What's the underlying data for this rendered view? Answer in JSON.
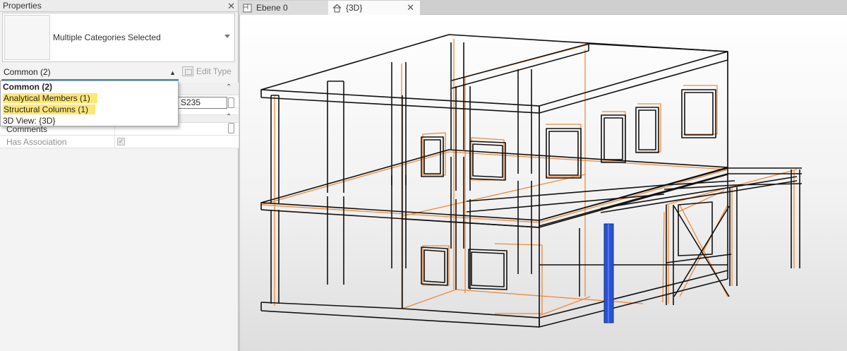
{
  "panel": {
    "title": "Properties",
    "close_glyph": "✕",
    "type_selector_label": "Multiple Categories Selected",
    "filter_value": "Common (2)",
    "edit_type_label": "Edit Type"
  },
  "dropdown": {
    "items": [
      {
        "label": "Common (2)"
      },
      {
        "label": "Analytical Members (1)"
      },
      {
        "label": "Structural Columns (1)"
      },
      {
        "label": "3D View: {3D}"
      }
    ]
  },
  "properties": {
    "material_value": "S235",
    "rows": [
      {
        "label": "Comments"
      },
      {
        "label": "Has Association"
      }
    ]
  },
  "tabs": [
    {
      "label": "Ebene 0",
      "icon": "floor-plan-icon"
    },
    {
      "label": "{3D}",
      "icon": "home-icon",
      "close": "✕"
    }
  ],
  "colors": {
    "selection_highlight": "#ffe777",
    "analytical_orange": "#f08a3a",
    "selected_column_blue": "#2a52d4",
    "accent_underline": "#3d8fb3"
  }
}
